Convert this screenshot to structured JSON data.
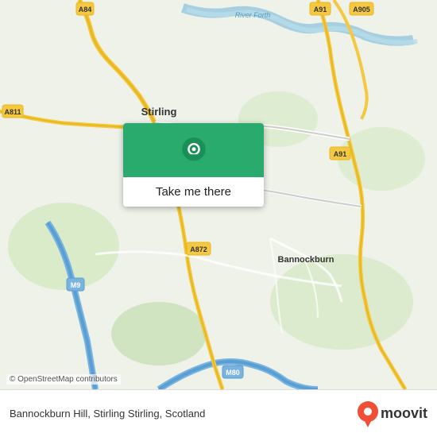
{
  "map": {
    "location": "Bannockburn Hill, Stirling Stirling, Scotland",
    "center_label": "Stirling",
    "road_labels": [
      "A84",
      "A811",
      "A91",
      "A905",
      "A872",
      "M9",
      "M80"
    ],
    "water_label": "River Forth",
    "area_label": "Bannockburn",
    "osm_credit": "© OpenStreetMap contributors"
  },
  "button": {
    "label": "Take me there"
  },
  "footer": {
    "location_text": "Bannockburn Hill, Stirling Stirling, Scotland",
    "brand": "moovit"
  }
}
